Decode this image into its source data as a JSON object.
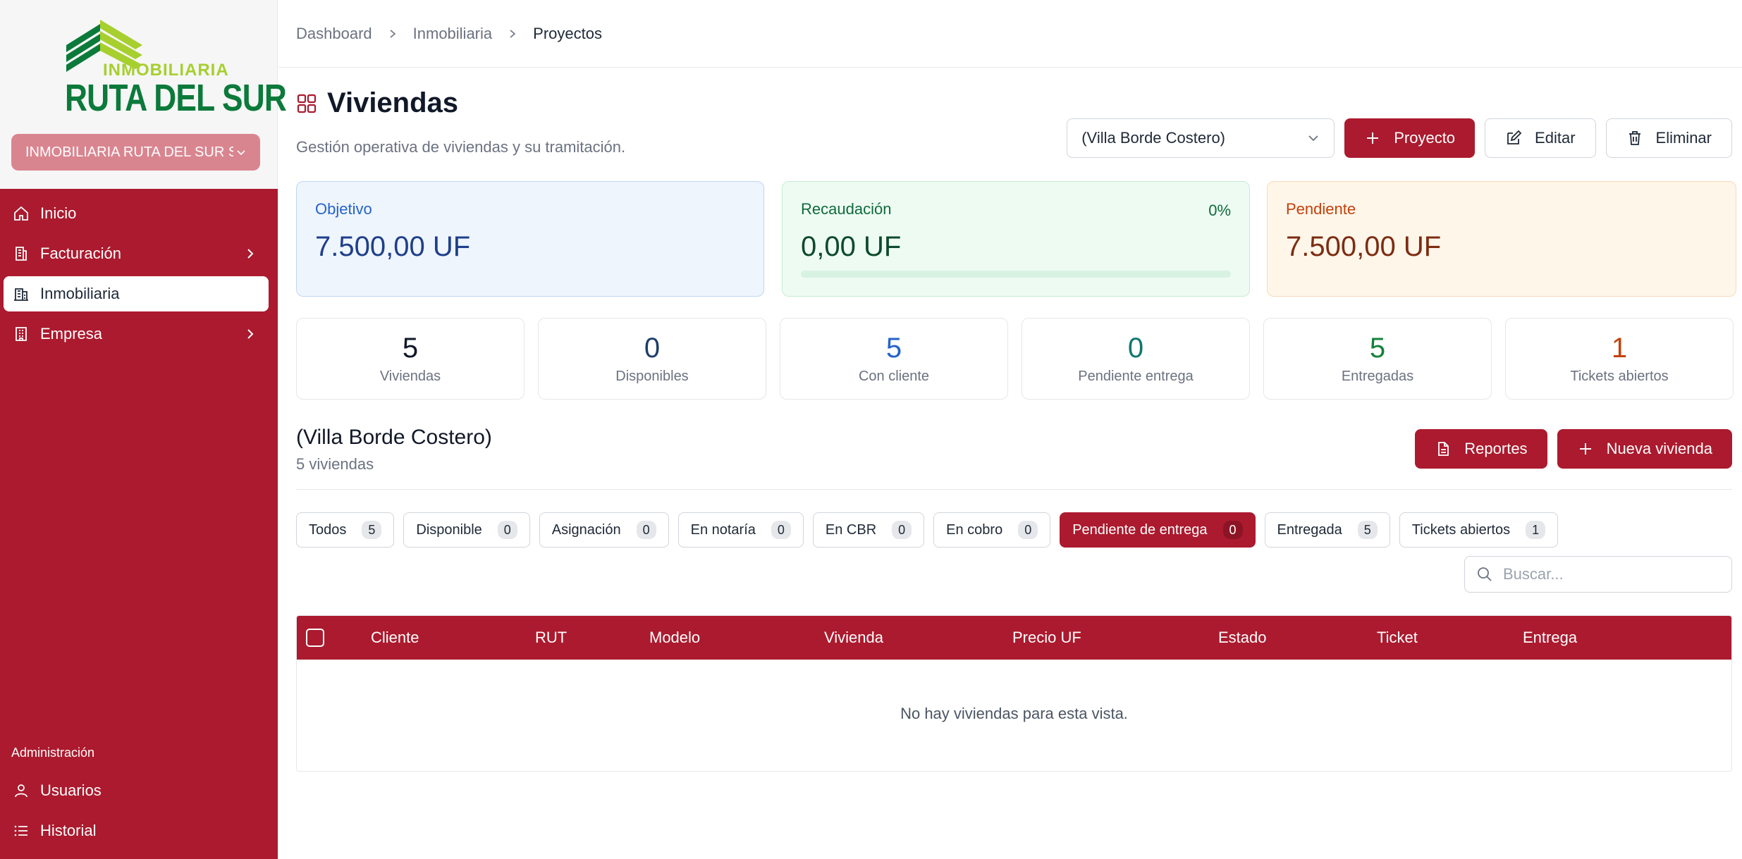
{
  "brand": {
    "logo_small": "INMOBILIARIA",
    "logo_big": "RUTA DEL SUR",
    "company_selector": "INMOBILIARIA RUTA DEL SUR SP..."
  },
  "nav": {
    "items": [
      {
        "label": "Inicio",
        "icon": "home-icon"
      },
      {
        "label": "Facturación",
        "icon": "receipt-icon"
      },
      {
        "label": "Inmobiliaria",
        "icon": "building-icon"
      },
      {
        "label": "Empresa",
        "icon": "office-icon"
      }
    ],
    "section_label": "Administración",
    "admin_items": [
      {
        "label": "Usuarios",
        "icon": "user-icon"
      },
      {
        "label": "Historial",
        "icon": "list-icon"
      }
    ]
  },
  "breadcrumb": [
    "Dashboard",
    "Inmobiliaria",
    "Proyectos"
  ],
  "page": {
    "title": "Viviendas",
    "subtitle": "Gestión operativa de viviendas y su tramitación."
  },
  "toolbar": {
    "project_select": "(Villa Borde Costero)",
    "add_project": "Proyecto",
    "edit": "Editar",
    "delete": "Eliminar"
  },
  "kpis": {
    "objetivo": {
      "label": "Objetivo",
      "value": "7.500,00 UF"
    },
    "recaudacion": {
      "label": "Recaudación",
      "value": "0,00 UF",
      "percent": "0%",
      "progress": 0
    },
    "pendiente": {
      "label": "Pendiente",
      "value": "7.500,00 UF"
    }
  },
  "stats": [
    {
      "value": "5",
      "label": "Viviendas",
      "color": "#111827"
    },
    {
      "value": "0",
      "label": "Disponibles",
      "color": "#1f3f6a"
    },
    {
      "value": "5",
      "label": "Con cliente",
      "color": "#2563c9"
    },
    {
      "value": "0",
      "label": "Pendiente entrega",
      "color": "#0f766e"
    },
    {
      "value": "5",
      "label": "Entregadas",
      "color": "#15803d"
    },
    {
      "value": "1",
      "label": "Tickets abiertos",
      "color": "#c2410c"
    }
  ],
  "section": {
    "title": "(Villa Borde Costero)",
    "subtitle": "5 viviendas",
    "reports": "Reportes",
    "new_unit": "Nueva vivienda"
  },
  "filters": [
    {
      "label": "Todos",
      "count": "5"
    },
    {
      "label": "Disponible",
      "count": "0"
    },
    {
      "label": "Asignación",
      "count": "0"
    },
    {
      "label": "En notaría",
      "count": "0"
    },
    {
      "label": "En CBR",
      "count": "0"
    },
    {
      "label": "En cobro",
      "count": "0"
    },
    {
      "label": "Pendiente de entrega",
      "count": "0",
      "active": true
    },
    {
      "label": "Entregada",
      "count": "5"
    },
    {
      "label": "Tickets abiertos",
      "count": "1"
    }
  ],
  "search": {
    "placeholder": "Buscar..."
  },
  "table": {
    "columns": [
      "Cliente",
      "RUT",
      "Modelo",
      "Vivienda",
      "Precio UF",
      "Estado",
      "Ticket",
      "Entrega"
    ],
    "empty": "No hay viviendas para esta vista."
  },
  "colors": {
    "brand": "#ab1a2e",
    "logo_green": "#0c7a3a",
    "logo_lime": "#a7cf2e"
  }
}
